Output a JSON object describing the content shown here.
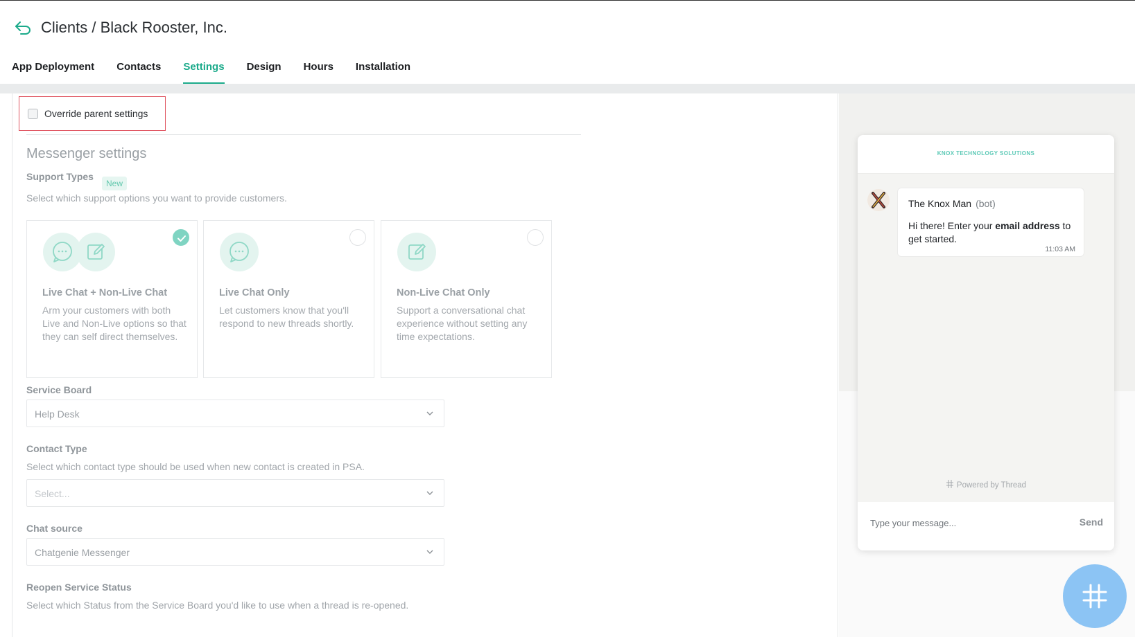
{
  "header": {
    "breadcrumb": "Clients / Black Rooster, Inc.",
    "tabs": [
      {
        "label": "App Deployment"
      },
      {
        "label": "Contacts"
      },
      {
        "label": "Settings"
      },
      {
        "label": "Design"
      },
      {
        "label": "Hours"
      },
      {
        "label": "Installation"
      }
    ],
    "active_tab": "Settings",
    "accent_color": "#1aaa8a"
  },
  "override": {
    "label": "Override parent settings",
    "checked": false,
    "highlight_color": "#e05561"
  },
  "messenger": {
    "title": "Messenger settings",
    "support_types": {
      "label": "Support Types",
      "badge": "New",
      "description": "Select which support options you want to provide customers.",
      "options": [
        {
          "title": "Live Chat + Non-Live Chat",
          "description": "Arm your customers with both Live and Non-Live options so that they can self direct themselves.",
          "selected": true,
          "icons": [
            "chat-bubble-icon",
            "edit-icon"
          ]
        },
        {
          "title": "Live Chat Only",
          "description": "Let customers know that you'll respond to new threads shortly.",
          "selected": false,
          "icons": [
            "chat-bubble-icon"
          ]
        },
        {
          "title": "Non-Live Chat Only",
          "description": "Support a conversational chat experience without setting any time expectations.",
          "selected": false,
          "icons": [
            "edit-icon"
          ]
        }
      ]
    },
    "service_board": {
      "label": "Service Board",
      "value": "Help Desk"
    },
    "contact_type": {
      "label": "Contact Type",
      "description": "Select which contact type should be used when new contact is created in PSA.",
      "placeholder": "Select..."
    },
    "chat_source": {
      "label": "Chat source",
      "value": "Chatgenie Messenger"
    },
    "reopen_status": {
      "label": "Reopen Service Status",
      "description": "Select which Status from the Service Board you'd like to use when a thread is re-opened."
    }
  },
  "preview": {
    "brand": "KNOX TECHNOLOGY SOLUTIONS",
    "sender": "The Knox Man",
    "sender_tag": "(bot)",
    "message_pre": "Hi there! Enter your ",
    "message_bold": "email address",
    "message_post": " to get started.",
    "time": "11:03 AM",
    "powered_by": "Powered by Thread",
    "input_placeholder": "Type your message...",
    "send_label": "Send",
    "launcher_color": "#8cc4f4"
  }
}
